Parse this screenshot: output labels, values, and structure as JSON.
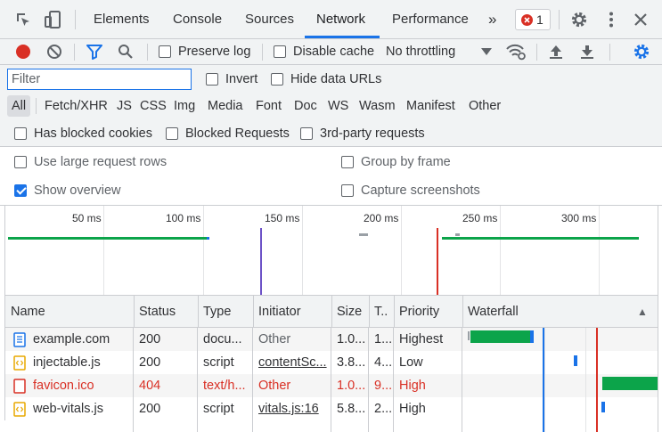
{
  "tabs": {
    "elements": "Elements",
    "console": "Console",
    "sources": "Sources",
    "network": "Network",
    "performance": "Performance",
    "more": "»",
    "error_count": "1"
  },
  "toolbar": {
    "preserve_log": "Preserve log",
    "disable_cache": "Disable cache",
    "throttling": "No throttling"
  },
  "filter": {
    "placeholder": "Filter",
    "invert": "Invert",
    "hide_data_urls": "Hide data URLs"
  },
  "types": [
    "All",
    "Fetch/XHR",
    "JS",
    "CSS",
    "Img",
    "Media",
    "Font",
    "Doc",
    "WS",
    "Wasm",
    "Manifest",
    "Other"
  ],
  "blocked": {
    "has_blocked_cookies": "Has blocked cookies",
    "blocked_requests": "Blocked Requests",
    "third_party": "3rd-party requests"
  },
  "settings": {
    "large_rows": "Use large request rows",
    "group_by_frame": "Group by frame",
    "show_overview": "Show overview",
    "capture_screenshots": "Capture screenshots",
    "show_overview_checked": true
  },
  "overview": {
    "ticks": [
      "50 ms",
      "100 ms",
      "150 ms",
      "200 ms",
      "250 ms",
      "300 ms"
    ]
  },
  "table": {
    "headers": {
      "name": "Name",
      "status": "Status",
      "type": "Type",
      "initiator": "Initiator",
      "size": "Size",
      "time": "T..",
      "priority": "Priority",
      "waterfall": "Waterfall",
      "sort_arrow": "▲"
    },
    "rows": [
      {
        "name": "example.com",
        "status": "200",
        "type": "docu...",
        "initiator": "Other",
        "size": "1.0...",
        "time": "1...",
        "priority": "Highest",
        "icon": "document-icon",
        "error": false
      },
      {
        "name": "injectable.js",
        "status": "200",
        "type": "script",
        "initiator": "contentSc...",
        "size": "3.8...",
        "time": "4...",
        "priority": "Low",
        "icon": "script-icon",
        "error": false
      },
      {
        "name": "favicon.ico",
        "status": "404",
        "type": "text/h...",
        "initiator": "Other",
        "size": "1.0...",
        "time": "9...",
        "priority": "High",
        "icon": "image-icon",
        "error": true
      },
      {
        "name": "web-vitals.js",
        "status": "200",
        "type": "script",
        "initiator": "vitals.js:16",
        "size": "5.8...",
        "time": "2...",
        "priority": "High",
        "icon": "script-icon",
        "error": false
      }
    ]
  },
  "colors": {
    "accent": "#1a73e8",
    "record": "#d93025",
    "waterfall_green": "#0ca44a",
    "dom_line": "#1a73e8",
    "load_line": "#d93025",
    "dcl_line": "#6d52c7"
  }
}
